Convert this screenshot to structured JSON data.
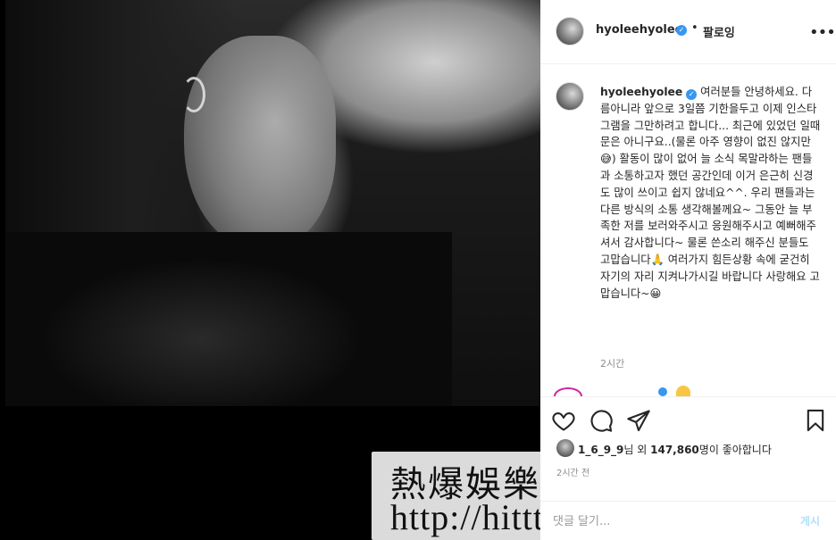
{
  "post": {
    "username": "hyoleehyolee",
    "follow_label": "팔로잉",
    "separator": "•",
    "more_label": "•••",
    "caption_username": "hyoleehyolee",
    "caption_text": "여러분들 안녕하세요. 다름아니라 앞으로 3일쯤 기한을두고 이제 인스타그램을 그만하려고 합니다... 최근에 있었던 일때문은 아니구요..(물론 아주 영향이 없진 않지만😅) 활동이 많이 없어 늘 소식 목말라하는 팬들과 소통하고자 했던 공간인데 이거 은근히 신경도 많이 쓰이고 쉽지 않네요^^. 우리 팬들과는 다른 방식의 소통 생각해볼께요~ 그동안 늘 부족한 저를 보러와주시고 응원해주시고 예뻐해주셔서 감사합니다~ 물론 쓴소리 해주신 분들도 고맙습니다🙏 여러가지 힘든상황 속에 굳건히 자기의 자리 지켜나가시길 바랍니다 사랑해요 고맙습니다~😀",
    "caption_time": "2시간",
    "likes_user": "1_6_9_9",
    "likes_text_mid": "님 외 ",
    "likes_count": "147,860",
    "likes_text_end": "명이 좋아합니다",
    "time_ago": "2시간 전",
    "comment_placeholder": "댓글 달기...",
    "post_button": "게시"
  },
  "watermark": {
    "title": "熱爆娛樂",
    "url": "http://hittt.blogspot.com"
  },
  "icons": {
    "verified": "verified-badge-icon",
    "heart": "heart-icon",
    "comment": "comment-icon",
    "share": "paper-plane-icon",
    "save": "bookmark-icon"
  },
  "colors": {
    "verified_blue": "#3897f0",
    "panel_bg": "#ffffff",
    "post_button": "#b2dffc",
    "muted_text": "#8e8e8e"
  }
}
